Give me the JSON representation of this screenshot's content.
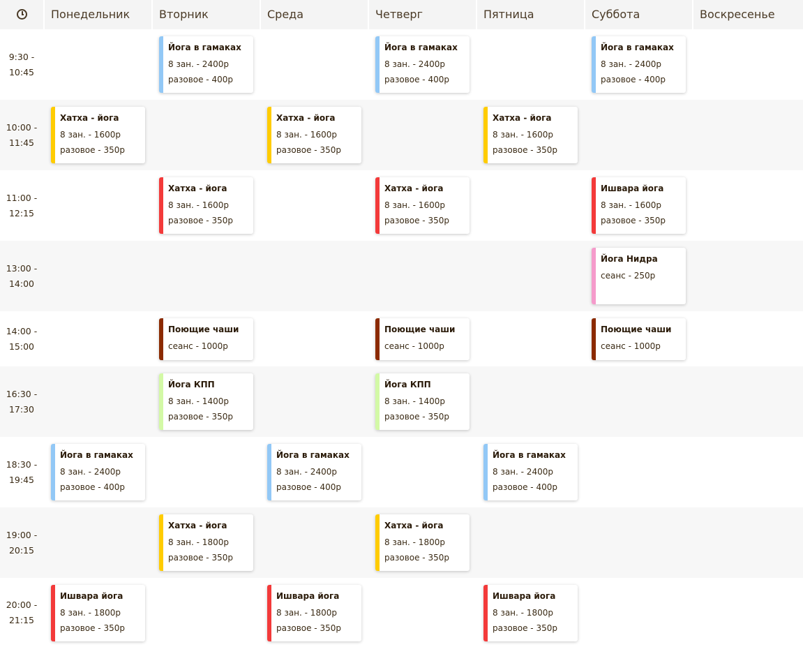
{
  "header": {
    "clock_icon": "clock-icon",
    "days": [
      "Понедельник",
      "Вторник",
      "Среда",
      "Четверг",
      "Пятница",
      "Суббота",
      "Воскресенье"
    ]
  },
  "colors": {
    "blue": "#92c8f6",
    "yellow": "#ffcc00",
    "red": "#f33a3a",
    "pink": "#f59bcb",
    "brown": "#8b2a00",
    "lightgreen": "#d3f9a6"
  },
  "rows": [
    {
      "start": "9:30 -",
      "end": "10:45",
      "classes": [
        {
          "day": 1,
          "name": "Йога в гамаках",
          "color": "blue",
          "lines": [
            "8 зан. - 2400р",
            "разовое - 400р"
          ]
        },
        {
          "day": 3,
          "name": "Йога в гамаках",
          "color": "blue",
          "lines": [
            "8 зан. - 2400р",
            "разовое - 400р"
          ]
        },
        {
          "day": 5,
          "name": "Йога в гамаках",
          "color": "blue",
          "lines": [
            "8 зан. - 2400р",
            "разовое - 400р"
          ]
        }
      ]
    },
    {
      "start": "10:00 -",
      "end": "11:45",
      "classes": [
        {
          "day": 0,
          "name": "Хатха - йога",
          "color": "yellow",
          "lines": [
            "8 зан. - 1600р",
            "разовое - 350р"
          ]
        },
        {
          "day": 2,
          "name": "Хатха - йога",
          "color": "yellow",
          "lines": [
            "8 зан. - 1600р",
            "разовое - 350р"
          ]
        },
        {
          "day": 4,
          "name": "Хатха - йога",
          "color": "yellow",
          "lines": [
            "8 зан. - 1600р",
            "разовое - 350р"
          ]
        }
      ]
    },
    {
      "start": "11:00 -",
      "end": "12:15",
      "classes": [
        {
          "day": 1,
          "name": "Хатха - йога",
          "color": "red",
          "lines": [
            "8 зан. - 1600р",
            "разовое - 350р"
          ]
        },
        {
          "day": 3,
          "name": "Хатха - йога",
          "color": "red",
          "lines": [
            "8 зан. - 1600р",
            "разовое - 350р"
          ]
        },
        {
          "day": 5,
          "name": "Ишвара йога",
          "color": "red",
          "lines": [
            "8 зан. - 1600р",
            "разовое - 350р"
          ]
        }
      ]
    },
    {
      "start": "13:00 -",
      "end": "14:00",
      "classes": [
        {
          "day": 5,
          "name": "Йога Нидра",
          "color": "pink",
          "lines": [
            "сеанс - 250р"
          ],
          "tall": true
        }
      ]
    },
    {
      "start": "14:00 -",
      "end": "15:00",
      "classes": [
        {
          "day": 1,
          "name": "Поющие чаши",
          "color": "brown",
          "lines": [
            "сеанс - 1000р"
          ]
        },
        {
          "day": 3,
          "name": "Поющие чаши",
          "color": "brown",
          "lines": [
            "сеанс - 1000р"
          ]
        },
        {
          "day": 5,
          "name": "Поющие чаши",
          "color": "brown",
          "lines": [
            "сеанс - 1000р"
          ]
        }
      ]
    },
    {
      "start": "16:30 -",
      "end": "17:30",
      "classes": [
        {
          "day": 1,
          "name": "Йога КПП",
          "color": "lightgreen",
          "lines": [
            "8 зан. - 1400р",
            "разовое - 350р"
          ]
        },
        {
          "day": 3,
          "name": "Йога КПП",
          "color": "lightgreen",
          "lines": [
            "8 зан. - 1400р",
            "разовое - 350р"
          ]
        }
      ]
    },
    {
      "start": "18:30 -",
      "end": "19:45",
      "classes": [
        {
          "day": 0,
          "name": "Йога в гамаках",
          "color": "blue",
          "lines": [
            "8 зан. - 2400р",
            "разовое - 400р"
          ]
        },
        {
          "day": 2,
          "name": "Йога в гамаках",
          "color": "blue",
          "lines": [
            "8 зан. - 2400р",
            "разовое - 400р"
          ]
        },
        {
          "day": 4,
          "name": "Йога в гамаках",
          "color": "blue",
          "lines": [
            "8 зан. - 2400р",
            "разовое - 400р"
          ]
        }
      ]
    },
    {
      "start": "19:00 -",
      "end": "20:15",
      "classes": [
        {
          "day": 1,
          "name": "Хатха - йога",
          "color": "yellow",
          "lines": [
            "8 зан. - 1800р",
            "разовое - 350р"
          ]
        },
        {
          "day": 3,
          "name": "Хатха - йога",
          "color": "yellow",
          "lines": [
            "8 зан. - 1800р",
            "разовое - 350р"
          ]
        }
      ]
    },
    {
      "start": "20:00 -",
      "end": "21:15",
      "classes": [
        {
          "day": 0,
          "name": "Ишвара йога",
          "color": "red",
          "lines": [
            "8 зан. - 1800р",
            "разовое - 350р"
          ]
        },
        {
          "day": 2,
          "name": "Ишвара йога",
          "color": "red",
          "lines": [
            "8 зан. - 1800р",
            "разовое - 350р"
          ]
        },
        {
          "day": 4,
          "name": "Ишвара йога",
          "color": "red",
          "lines": [
            "8 зан. - 1800р",
            "разовое - 350р"
          ]
        }
      ]
    }
  ]
}
